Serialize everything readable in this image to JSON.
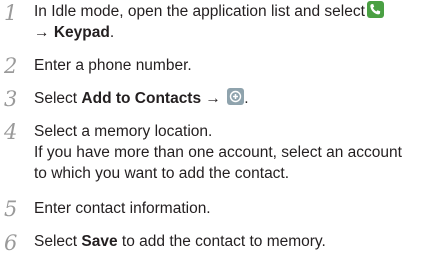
{
  "steps": [
    {
      "number": "1",
      "line1_text": "In Idle mode, open the application list and select",
      "line1_icon": "phone-icon",
      "line2_arrow": "→",
      "line2_bold": "Keypad",
      "line2_suffix": "."
    },
    {
      "number": "2",
      "text": "Enter a phone number."
    },
    {
      "number": "3",
      "prefix": "Select",
      "bold": "Add to Contacts",
      "arrow": "→",
      "icon": "add-icon",
      "suffix": "."
    },
    {
      "number": "4",
      "text": "Select a memory location.",
      "note_line1": "If you have more than one account, select an account",
      "note_line2": "to which you want to add the contact."
    },
    {
      "number": "5",
      "text": "Enter contact information."
    },
    {
      "number": "6",
      "prefix": "Select",
      "bold": "Save",
      "suffix": "to add the contact to memory."
    }
  ],
  "colors": {
    "text": "#231f20",
    "step_number": "#9a9a9a",
    "phone_icon": "#4aa043",
    "add_icon": "#8fa3ad"
  }
}
